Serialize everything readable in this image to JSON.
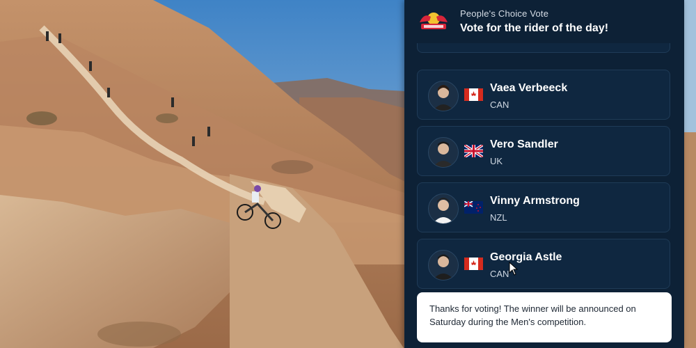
{
  "header": {
    "subtitle": "People's Choice Vote",
    "title": "Vote for the rider of the day!",
    "logo_icon": "red-bull-rampage-logo-icon"
  },
  "riders": [
    {
      "name": "Vaea Verbeeck",
      "country": "CAN",
      "flag_icon": "canada-flag-icon"
    },
    {
      "name": "Vero Sandler",
      "country": "UK",
      "flag_icon": "uk-flag-icon"
    },
    {
      "name": "Vinny Armstrong",
      "country": "NZL",
      "flag_icon": "new-zealand-flag-icon"
    },
    {
      "name": "Georgia Astle",
      "country": "CAN",
      "flag_icon": "canada-flag-icon"
    }
  ],
  "notice": {
    "text": "Thanks for voting! The winner will be announced on Saturday during the Men's competition."
  },
  "colors": {
    "panel_bg": "#0d2136",
    "card_bg": "#0f2740",
    "card_border": "#1f3b57",
    "notice_bg": "#ffffff"
  }
}
